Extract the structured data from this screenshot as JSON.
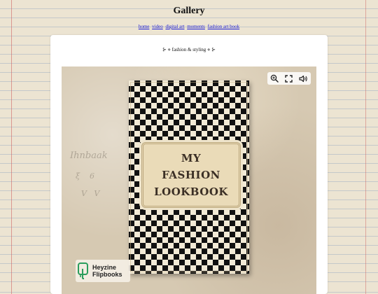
{
  "site": {
    "title": "Gallery",
    "nav": [
      "home",
      "video",
      "digital art",
      "moments",
      "fashion art book"
    ]
  },
  "section": {
    "title": "⊱ ⋄ fashion & styling ⋄ ⊱"
  },
  "viewer": {
    "tools": [
      "zoom-in-icon",
      "fullscreen-icon",
      "sound-icon"
    ],
    "book_title_lines": [
      "MY",
      "FASHION",
      "LOOKBOOK"
    ],
    "brand_lines": [
      "Heyzine",
      "Flipbooks"
    ]
  },
  "colors": {
    "link": "#1a1ad6",
    "panel": "#ffffff",
    "pattern_dark": "#111111",
    "pattern_light": "#f2ead6",
    "label_bg": "#eadbb8",
    "brand_green": "#2a9d5c"
  }
}
